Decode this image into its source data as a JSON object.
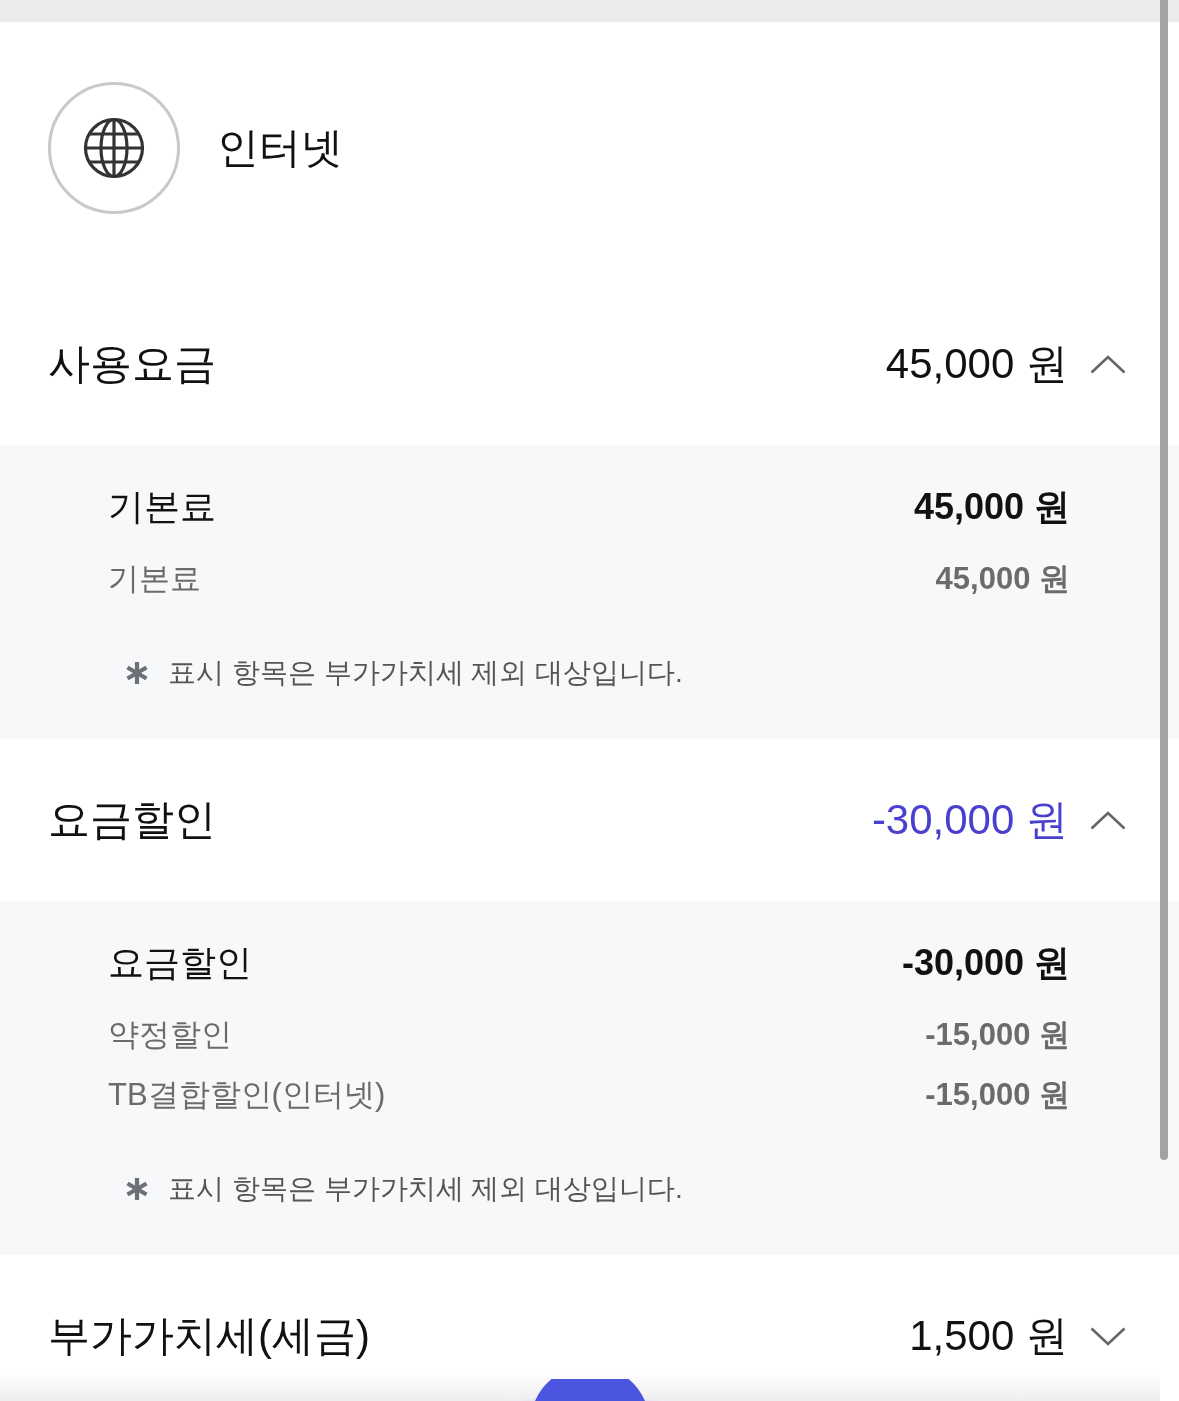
{
  "header": {
    "title": "인터넷"
  },
  "sections": [
    {
      "title": "사용요금",
      "amount": "45,000 원",
      "kind": "charge",
      "expanded": true,
      "detail": {
        "subtotal": {
          "label": "기본료",
          "amount": "45,000 원"
        },
        "items": [
          {
            "label": "기본료",
            "amount": "45,000 원"
          }
        ],
        "note": "표시 항목은 부가가치세 제외 대상입니다."
      }
    },
    {
      "title": "요금할인",
      "amount": "-30,000 원",
      "kind": "discount",
      "expanded": true,
      "detail": {
        "subtotal": {
          "label": "요금할인",
          "amount": "-30,000 원"
        },
        "items": [
          {
            "label": "약정할인",
            "amount": "-15,000 원"
          },
          {
            "label": "TB결합할인(인터넷)",
            "amount": "-15,000 원"
          }
        ],
        "note": "표시 항목은 부가가치세 제외 대상입니다."
      }
    },
    {
      "title": "부가가치세(세금)",
      "amount": "1,500 원",
      "kind": "charge",
      "expanded": false
    }
  ]
}
